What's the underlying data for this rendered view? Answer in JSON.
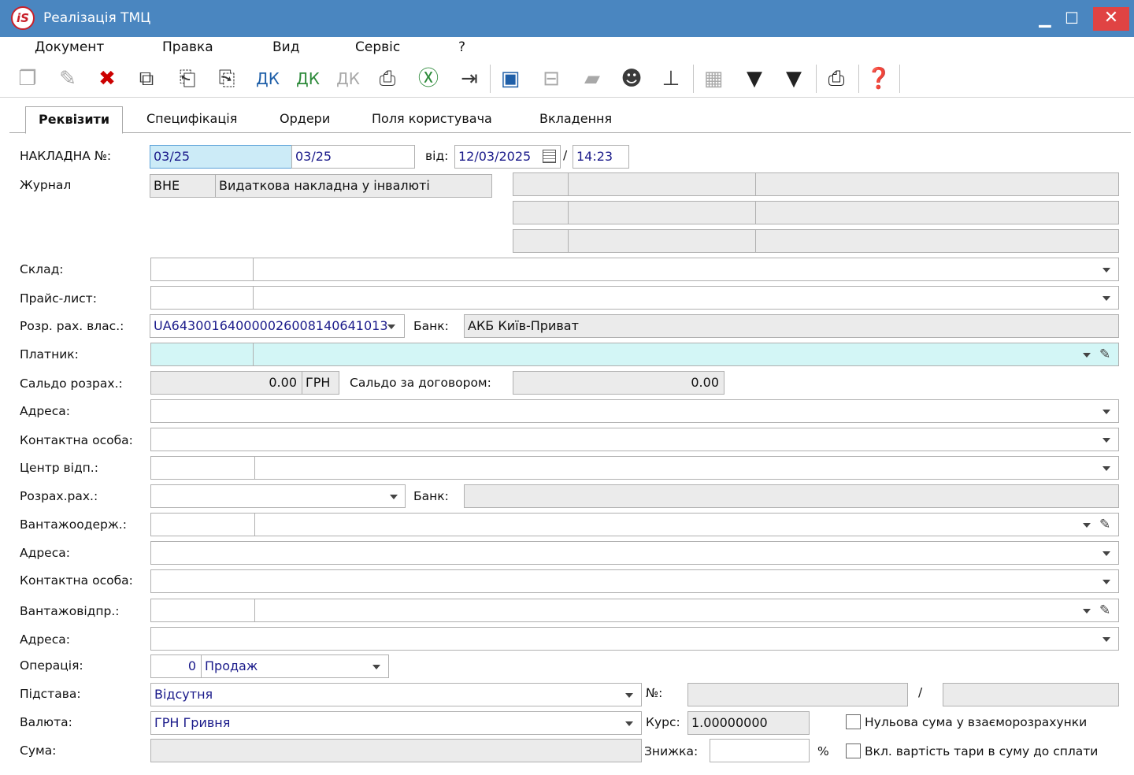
{
  "window": {
    "title": "Реалізація ТМЦ",
    "logo_text": "iS"
  },
  "menu": [
    "Документ",
    "Правка",
    "Вид",
    "Сервіс",
    "?"
  ],
  "tabs": [
    "Реквізити",
    "Специфікація",
    "Ордери",
    "Поля користувача",
    "Вкладення"
  ],
  "form": {
    "invoice_label": "НАКЛАДНА №:",
    "invoice_no": "03/25",
    "invoice_no2": "03/25",
    "date_label": "від:",
    "date": "12/03/2025",
    "time_sep": "/",
    "time": "14:23",
    "journal_label": "Журнал",
    "journal_code": "ВНЕ",
    "journal_name": "Видаткова накладна у інвалюті",
    "warehouse_label": "Склад:",
    "pricelist_label": "Прайс-лист:",
    "own_account_label": "Розр. рах. влас.:",
    "own_account": "UA643001640000026008140641013",
    "bank_label": "Банк:",
    "bank": "АКБ Київ-Приват",
    "payer_label": "Платник:",
    "balance_label": "Сальдо розрах.:",
    "balance": "0.00",
    "balance_currency": "ГРН",
    "contract_balance_label": "Сальдо за договором:",
    "contract_balance": "0.00",
    "address_label": "Адреса:",
    "contact_label": "Контактна особа:",
    "center_label": "Центр відп.:",
    "account_label": "Розрах.рах.:",
    "bank2_label": "Банк:",
    "consignee_label": "Вантажоодерж.:",
    "address2_label": "Адреса:",
    "contact2_label": "Контактна особа:",
    "shipper_label": "Вантажовідпр.:",
    "address3_label": "Адреса:",
    "operation_label": "Операція:",
    "operation_code": "0",
    "operation": "Продаж",
    "basis_label": "Підстава:",
    "basis": "Відсутня",
    "number_label": "№:",
    "number_sep": "/",
    "currency_label": "Валюта:",
    "currency": "ГРН Гривня",
    "rate_label": "Курс:",
    "rate": "1.00000000",
    "zero_sum_label": "Нульова сума у взаєморозрахунки",
    "sum_label": "Сума:",
    "discount_label": "Знижка:",
    "percent": "%",
    "tare_label": "Вкл. вартість тари в суму до сплати"
  }
}
